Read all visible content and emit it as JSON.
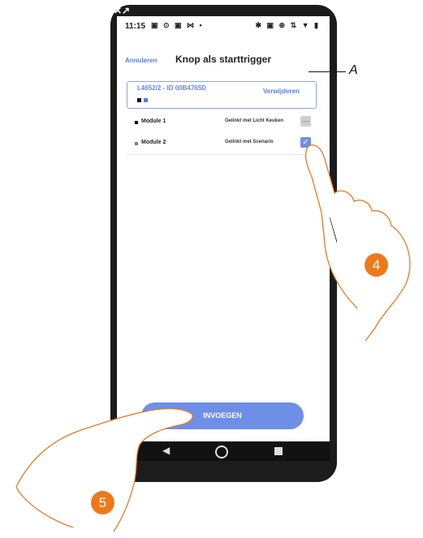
{
  "status_bar": {
    "time": "11:15",
    "left_icons": "▣ ⊙ ▣ ⋈ •",
    "right_icons": "✱ ▣ ⊕ ⇅ ▼ ▮"
  },
  "header": {
    "cancel_label": "Annuleren",
    "title": "Knop als starttrigger"
  },
  "device": {
    "id_label": "L4652/2 - ID 00B4765D",
    "remove_label": "Verwijderen"
  },
  "modules": [
    {
      "name": "Module 1",
      "link": "Gelinkt met Licht Keuken",
      "checked": false,
      "color": "#111111"
    },
    {
      "name": "Module 2",
      "link": "Gelinkt met Scenario",
      "checked": true,
      "color": "#5b7dd8"
    }
  ],
  "insert_button_label": "INVOEGEN",
  "annotations": {
    "callout": "A",
    "step_4": "4",
    "step_5": "5"
  },
  "colors": {
    "accent": "#6f8fe6",
    "step_badge": "#ec7a1c"
  }
}
